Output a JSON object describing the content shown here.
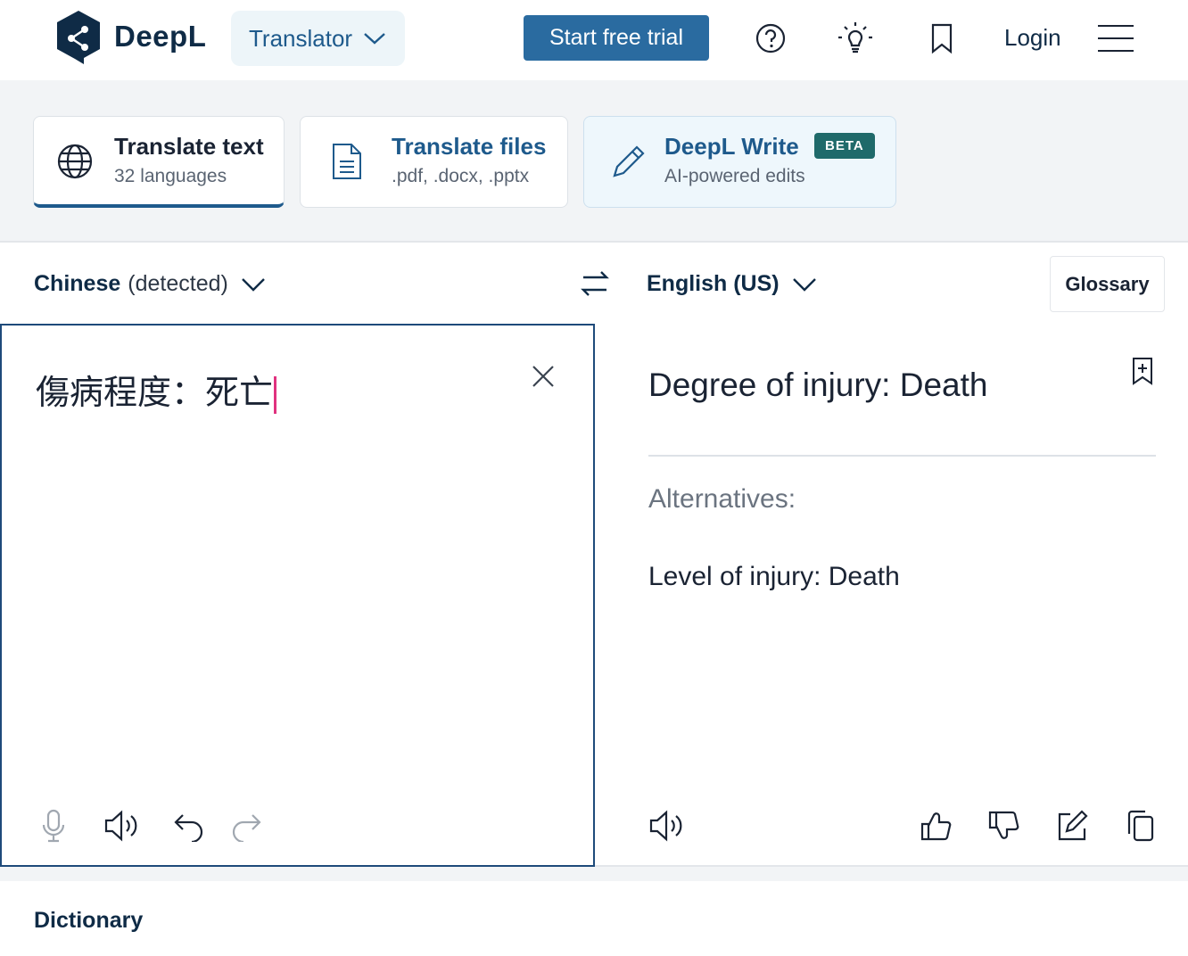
{
  "header": {
    "logo_text": "DeepL",
    "translator_label": "Translator",
    "trial_label": "Start free trial",
    "login_label": "Login"
  },
  "modes": [
    {
      "title": "Translate text",
      "subtitle": "32 languages"
    },
    {
      "title": "Translate files",
      "subtitle": ".pdf, .docx, .pptx"
    },
    {
      "title": "DeepL Write",
      "subtitle": "AI-powered edits",
      "badge": "BETA"
    }
  ],
  "langbar": {
    "source_lang": "Chinese",
    "source_detected": "(detected)",
    "target_lang": "English (US)",
    "glossary_label": "Glossary"
  },
  "source": {
    "text": "傷病程度：死亡"
  },
  "target": {
    "text": "Degree of injury: Death",
    "alternatives_label": "Alternatives:",
    "alternatives": [
      "Level of injury: Death"
    ]
  },
  "dictionary": {
    "label": "Dictionary"
  },
  "colors": {
    "brand_dark": "#0f2b46",
    "brand_blue": "#2a6ba0",
    "beta_badge": "#1f6a6a",
    "caret": "#e0327f"
  }
}
